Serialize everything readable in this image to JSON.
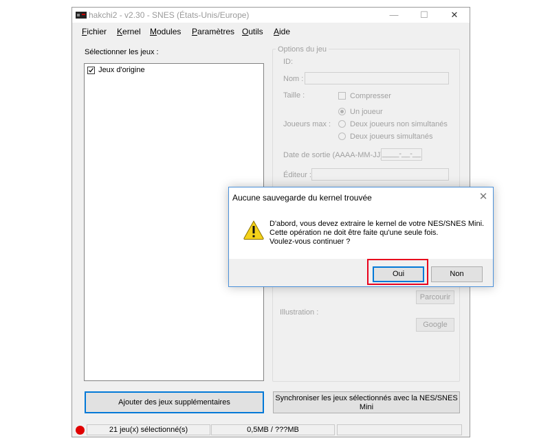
{
  "window": {
    "title": "hakchi2 - v2.30 - SNES (États-Unis/Europe)",
    "minimize_glyph": "—",
    "maximize_glyph": "☐",
    "close_glyph": "✕"
  },
  "menu": [
    {
      "accel": "F",
      "rest": "ichier"
    },
    {
      "accel": "K",
      "rest": "ernel"
    },
    {
      "accel": "M",
      "rest": "odules"
    },
    {
      "accel": "P",
      "rest": "aramètres"
    },
    {
      "accel": "O",
      "rest": "utils"
    },
    {
      "accel": "A",
      "rest": "ide"
    }
  ],
  "games": {
    "label": "Sélectionner les jeux :",
    "items": [
      {
        "label": "Jeux d'origine",
        "checked": true
      }
    ]
  },
  "options": {
    "legend": "Options du jeu",
    "id_label": "ID:",
    "name_label": "Nom :",
    "size_label": "Taille :",
    "compress_label": "Compresser",
    "players_label": "Joueurs max :",
    "radio_one": "Un joueur",
    "radio_two_alt": "Deux joueurs non simultanés",
    "radio_two_sim": "Deux joueurs simultanés",
    "release_label": "Date de sortie (AAAA-MM-JJ) :",
    "release_value": "____-__-__",
    "publisher_label": "Éditeur :",
    "browse_label": "Parcourir",
    "illustration_label": "Illustration :",
    "google_label": "Google"
  },
  "buttons": {
    "add_games": "Ajouter des jeux supplémentaires",
    "sync_line1": "Synchroniser les jeux sélectionnés avec la NES/SNES",
    "sync_line2": "Mini"
  },
  "status": {
    "selected": "21 jeu(x) sélectionné(s)",
    "size": "0,5MB / ???MB",
    "led_color": "#e00000"
  },
  "dialog": {
    "title": "Aucune sauvegarde du kernel trouvée",
    "close_glyph": "✕",
    "lines": [
      "D'abord, vous devez extraire le kernel de votre NES/SNES Mini.",
      "Cette opération ne doit être faite qu'une seule fois.",
      "Voulez-vous continuer ?"
    ],
    "yes_label": "Oui",
    "no_label": "Non",
    "highlight_color": "#e8001c"
  }
}
